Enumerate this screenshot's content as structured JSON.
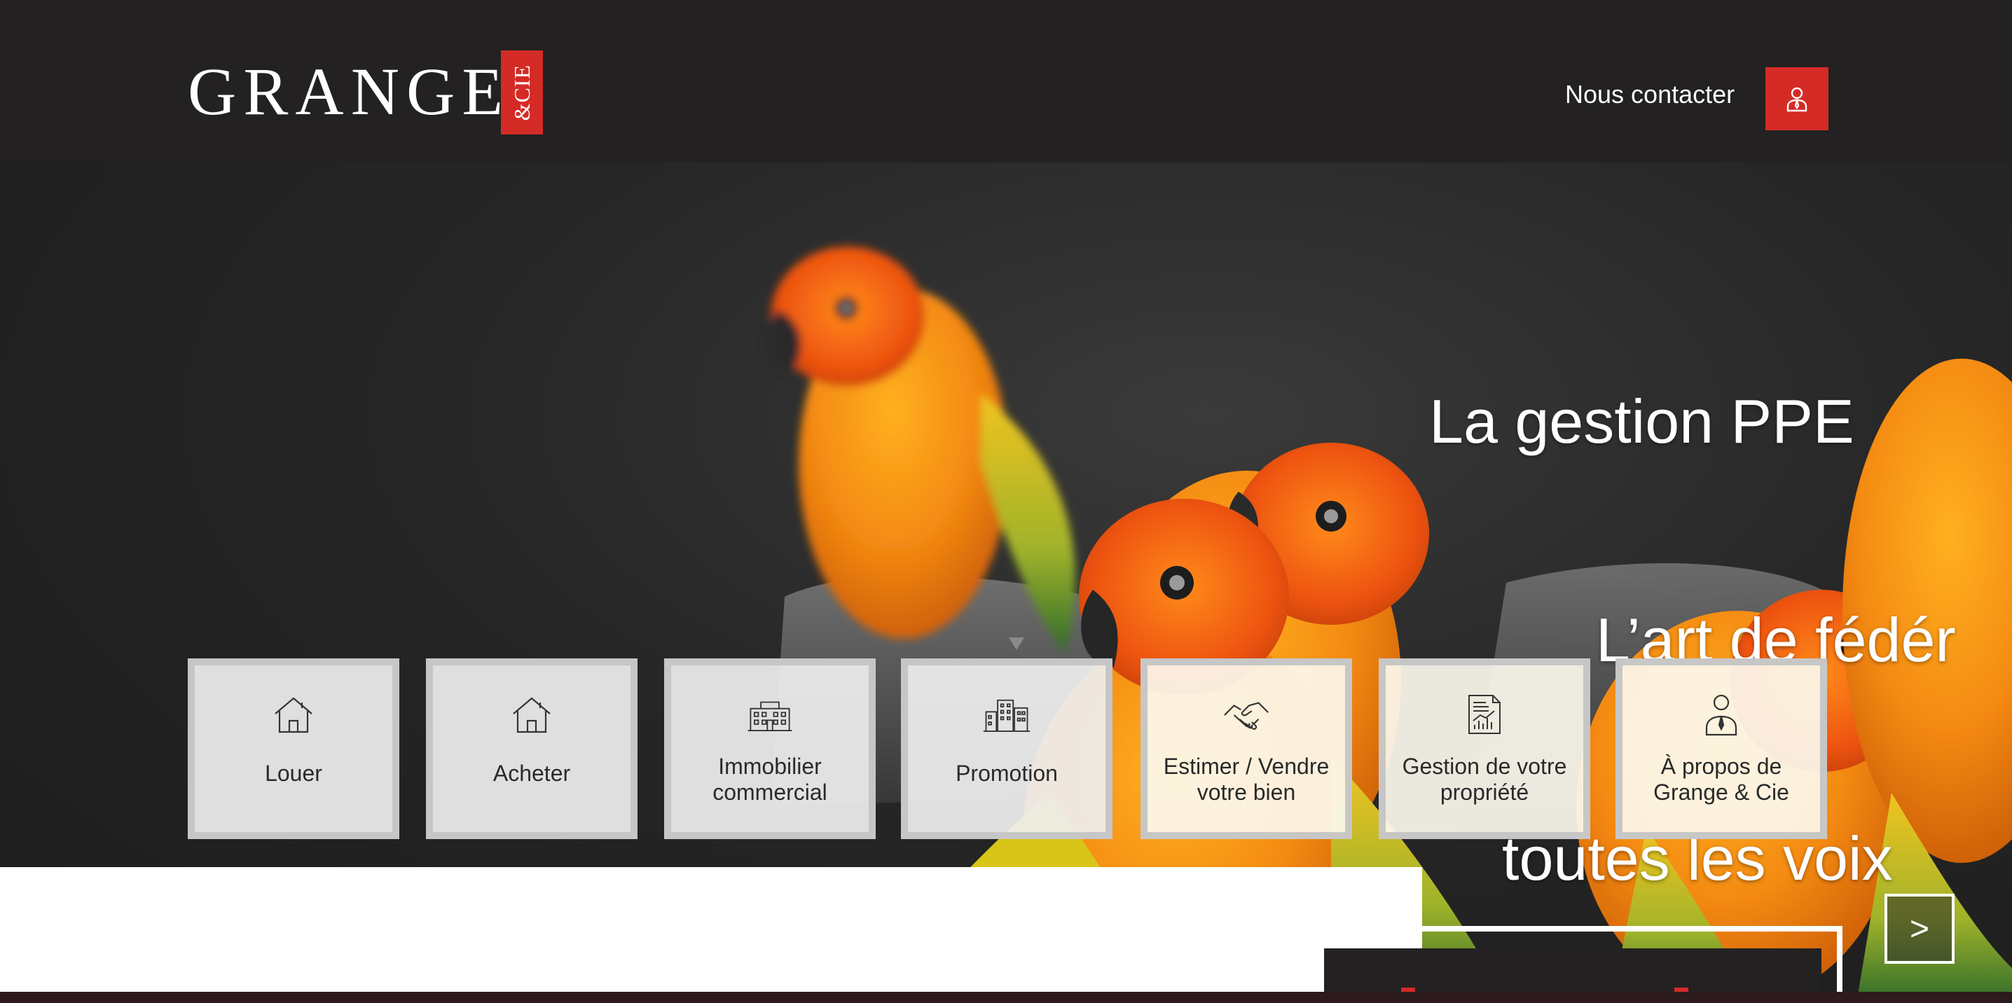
{
  "header": {
    "logo_text": "GRANGE",
    "logo_badge": "&CIE",
    "contact_label": "Nous contacter",
    "account_icon": "user-icon"
  },
  "hero": {
    "headline": {
      "line1": "La gestion PPE",
      "line2": "L’art de fédér",
      "line3": "toutes les voix"
    }
  },
  "tiles": [
    {
      "label": "Louer",
      "icon": "house-icon"
    },
    {
      "label": "Acheter",
      "icon": "house-icon"
    },
    {
      "label": "Immobilier\ncommercial",
      "icon": "office-building-icon"
    },
    {
      "label": "Promotion",
      "icon": "buildings-icon"
    },
    {
      "label": "Estimer / Vendre\nvotre bien",
      "icon": "handshake-icon"
    },
    {
      "label": "Gestion de votre\npropriété",
      "icon": "report-chart-icon"
    },
    {
      "label": "À propos de\nGrange & Cie",
      "icon": "person-icon"
    }
  ],
  "carousel": {
    "next_label": ">"
  },
  "colors": {
    "brand_red": "#d52b26",
    "header_bg": "#232122",
    "tile_bg": "#eeeeee",
    "tile_border": "#c4c4c4"
  }
}
